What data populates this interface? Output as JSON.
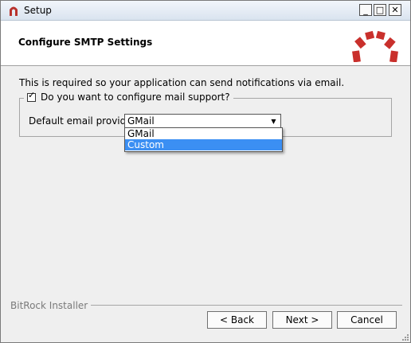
{
  "window": {
    "title": "Setup",
    "minimize_glyph": "_",
    "maximize_glyph": "□",
    "close_glyph": "✕"
  },
  "header": {
    "title": "Configure SMTP Settings",
    "logo_color": "#c9302c"
  },
  "content": {
    "intro_text": "This is required so your application can send notifications via email.",
    "mail_support_checkbox": {
      "label": "Do you want to configure mail support?",
      "checked": true,
      "check_glyph": "✓"
    },
    "provider": {
      "label": "Default email provider:",
      "value": "GMail",
      "options": [
        "GMail",
        "Custom"
      ],
      "highlighted_option": "Custom"
    }
  },
  "footer": {
    "installer_label": "BitRock Installer",
    "back_label": "< Back",
    "next_label": "Next >",
    "cancel_label": "Cancel"
  },
  "colors": {
    "selection": "#3b8ff3",
    "window_bg": "#efefef"
  }
}
